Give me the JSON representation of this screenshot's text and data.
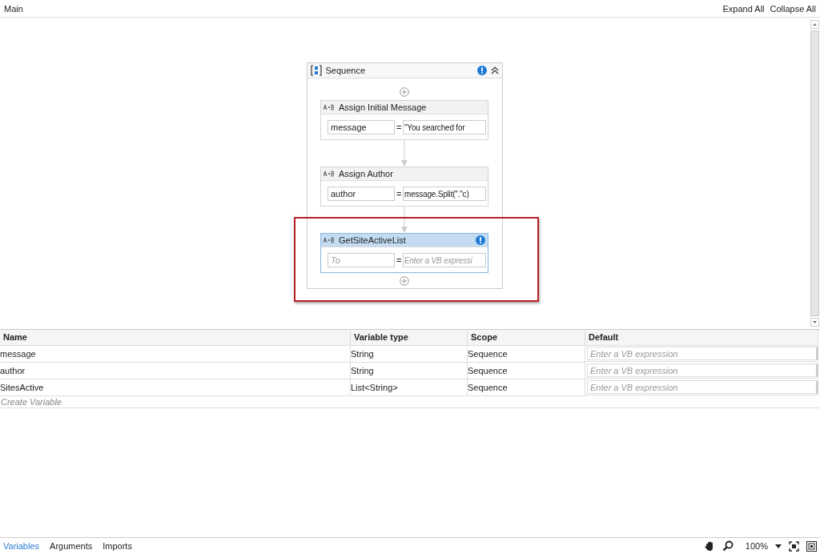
{
  "breadcrumb": "Main",
  "toolbar": {
    "expand_all": "Expand All",
    "collapse_all": "Collapse All"
  },
  "sequence": {
    "title": "Sequence",
    "warning": true,
    "expanded": true,
    "activities": [
      {
        "title": "Assign Initial Message",
        "selected": false,
        "warning": false,
        "to": {
          "value": "message"
        },
        "operator": "=",
        "expression": {
          "value": "\"You searched for"
        }
      },
      {
        "title": "Assign Author",
        "selected": false,
        "warning": false,
        "to": {
          "value": "author"
        },
        "operator": "=",
        "expression": {
          "value": "message.Split(\".\"c)"
        }
      },
      {
        "title": "GetSiteActiveList",
        "selected": true,
        "warning": true,
        "to": {
          "placeholder": "To"
        },
        "operator": "=",
        "expression": {
          "placeholder": "Enter a VB expressi"
        }
      }
    ]
  },
  "variables": {
    "columns": [
      "Name",
      "Variable type",
      "Scope",
      "Default"
    ],
    "rows": [
      {
        "name": "message",
        "type": "String",
        "scope": "Sequence",
        "default_placeholder": "Enter a VB expression"
      },
      {
        "name": "author",
        "type": "String",
        "scope": "Sequence",
        "default_placeholder": "Enter a VB expression"
      },
      {
        "name": "SitesActive",
        "type": "List<String>",
        "scope": "Sequence",
        "default_placeholder": "Enter a VB expression"
      }
    ],
    "create_placeholder": "Create Variable"
  },
  "bottom_tabs": [
    {
      "label": "Variables",
      "selected": true
    },
    {
      "label": "Arguments",
      "selected": false
    },
    {
      "label": "Imports",
      "selected": false
    }
  ],
  "zoom": "100%"
}
